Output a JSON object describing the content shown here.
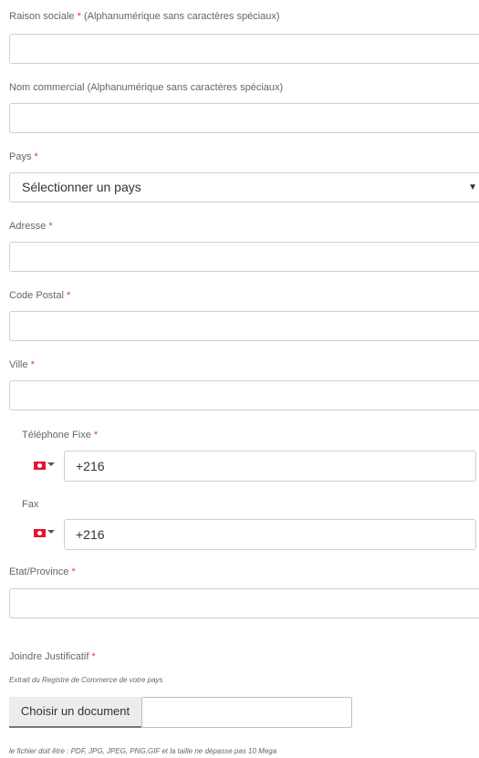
{
  "form": {
    "raison_sociale": {
      "label": "Raison sociale",
      "required": "*",
      "hint": " (Alphanumérique sans caractères spéciaux)",
      "value": ""
    },
    "nom_commercial": {
      "label": "Nom commercial (Alphanumérique sans caractères spéciaux)",
      "value": ""
    },
    "pays": {
      "label": "Pays",
      "required": "*",
      "selected": "Sélectionner un pays",
      "arrow": "▼"
    },
    "adresse": {
      "label": "Adresse",
      "required": "*",
      "value": ""
    },
    "code_postal": {
      "label": "Code Postal",
      "required": "*",
      "value": ""
    },
    "ville": {
      "label": "Ville",
      "required": "*",
      "value": ""
    },
    "telephone_fixe": {
      "label": "Téléphone Fixe",
      "required": "*",
      "value": "+216",
      "flag_icon": "tunisia-flag-icon"
    },
    "fax": {
      "label": "Fax",
      "value": "+216",
      "flag_icon": "tunisia-flag-icon"
    },
    "etat_province": {
      "label": "Etat/Province",
      "required": "*",
      "value": ""
    },
    "justificatif": {
      "label": "Joindre Justificatif",
      "required": "*",
      "description": "Extrait du Registre de Commerce de votre pays",
      "button_label": "Choisir un document",
      "file_name": "",
      "note": "le fichier doit être : PDF, JPG, JPEG, PNG,GIF et la taille ne dépasse pas 10 Mega"
    }
  },
  "colors": {
    "required": "#e53935",
    "flag": "#e8112d",
    "border": "#cfcfcf"
  }
}
